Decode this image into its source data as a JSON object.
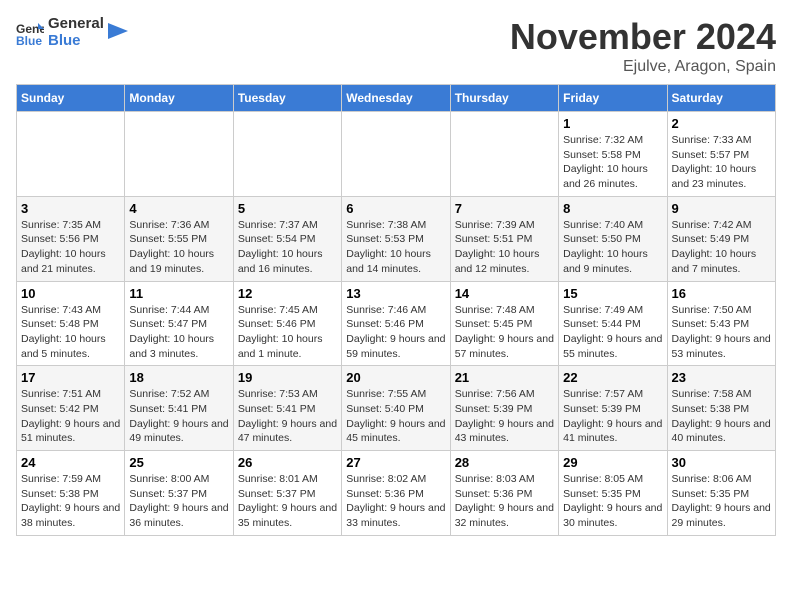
{
  "logo": {
    "line1": "General",
    "line2": "Blue"
  },
  "title": "November 2024",
  "location": "Ejulve, Aragon, Spain",
  "weekdays": [
    "Sunday",
    "Monday",
    "Tuesday",
    "Wednesday",
    "Thursday",
    "Friday",
    "Saturday"
  ],
  "weeks": [
    [
      {
        "day": "",
        "info": ""
      },
      {
        "day": "",
        "info": ""
      },
      {
        "day": "",
        "info": ""
      },
      {
        "day": "",
        "info": ""
      },
      {
        "day": "",
        "info": ""
      },
      {
        "day": "1",
        "info": "Sunrise: 7:32 AM\nSunset: 5:58 PM\nDaylight: 10 hours and 26 minutes."
      },
      {
        "day": "2",
        "info": "Sunrise: 7:33 AM\nSunset: 5:57 PM\nDaylight: 10 hours and 23 minutes."
      }
    ],
    [
      {
        "day": "3",
        "info": "Sunrise: 7:35 AM\nSunset: 5:56 PM\nDaylight: 10 hours and 21 minutes."
      },
      {
        "day": "4",
        "info": "Sunrise: 7:36 AM\nSunset: 5:55 PM\nDaylight: 10 hours and 19 minutes."
      },
      {
        "day": "5",
        "info": "Sunrise: 7:37 AM\nSunset: 5:54 PM\nDaylight: 10 hours and 16 minutes."
      },
      {
        "day": "6",
        "info": "Sunrise: 7:38 AM\nSunset: 5:53 PM\nDaylight: 10 hours and 14 minutes."
      },
      {
        "day": "7",
        "info": "Sunrise: 7:39 AM\nSunset: 5:51 PM\nDaylight: 10 hours and 12 minutes."
      },
      {
        "day": "8",
        "info": "Sunrise: 7:40 AM\nSunset: 5:50 PM\nDaylight: 10 hours and 9 minutes."
      },
      {
        "day": "9",
        "info": "Sunrise: 7:42 AM\nSunset: 5:49 PM\nDaylight: 10 hours and 7 minutes."
      }
    ],
    [
      {
        "day": "10",
        "info": "Sunrise: 7:43 AM\nSunset: 5:48 PM\nDaylight: 10 hours and 5 minutes."
      },
      {
        "day": "11",
        "info": "Sunrise: 7:44 AM\nSunset: 5:47 PM\nDaylight: 10 hours and 3 minutes."
      },
      {
        "day": "12",
        "info": "Sunrise: 7:45 AM\nSunset: 5:46 PM\nDaylight: 10 hours and 1 minute."
      },
      {
        "day": "13",
        "info": "Sunrise: 7:46 AM\nSunset: 5:46 PM\nDaylight: 9 hours and 59 minutes."
      },
      {
        "day": "14",
        "info": "Sunrise: 7:48 AM\nSunset: 5:45 PM\nDaylight: 9 hours and 57 minutes."
      },
      {
        "day": "15",
        "info": "Sunrise: 7:49 AM\nSunset: 5:44 PM\nDaylight: 9 hours and 55 minutes."
      },
      {
        "day": "16",
        "info": "Sunrise: 7:50 AM\nSunset: 5:43 PM\nDaylight: 9 hours and 53 minutes."
      }
    ],
    [
      {
        "day": "17",
        "info": "Sunrise: 7:51 AM\nSunset: 5:42 PM\nDaylight: 9 hours and 51 minutes."
      },
      {
        "day": "18",
        "info": "Sunrise: 7:52 AM\nSunset: 5:41 PM\nDaylight: 9 hours and 49 minutes."
      },
      {
        "day": "19",
        "info": "Sunrise: 7:53 AM\nSunset: 5:41 PM\nDaylight: 9 hours and 47 minutes."
      },
      {
        "day": "20",
        "info": "Sunrise: 7:55 AM\nSunset: 5:40 PM\nDaylight: 9 hours and 45 minutes."
      },
      {
        "day": "21",
        "info": "Sunrise: 7:56 AM\nSunset: 5:39 PM\nDaylight: 9 hours and 43 minutes."
      },
      {
        "day": "22",
        "info": "Sunrise: 7:57 AM\nSunset: 5:39 PM\nDaylight: 9 hours and 41 minutes."
      },
      {
        "day": "23",
        "info": "Sunrise: 7:58 AM\nSunset: 5:38 PM\nDaylight: 9 hours and 40 minutes."
      }
    ],
    [
      {
        "day": "24",
        "info": "Sunrise: 7:59 AM\nSunset: 5:38 PM\nDaylight: 9 hours and 38 minutes."
      },
      {
        "day": "25",
        "info": "Sunrise: 8:00 AM\nSunset: 5:37 PM\nDaylight: 9 hours and 36 minutes."
      },
      {
        "day": "26",
        "info": "Sunrise: 8:01 AM\nSunset: 5:37 PM\nDaylight: 9 hours and 35 minutes."
      },
      {
        "day": "27",
        "info": "Sunrise: 8:02 AM\nSunset: 5:36 PM\nDaylight: 9 hours and 33 minutes."
      },
      {
        "day": "28",
        "info": "Sunrise: 8:03 AM\nSunset: 5:36 PM\nDaylight: 9 hours and 32 minutes."
      },
      {
        "day": "29",
        "info": "Sunrise: 8:05 AM\nSunset: 5:35 PM\nDaylight: 9 hours and 30 minutes."
      },
      {
        "day": "30",
        "info": "Sunrise: 8:06 AM\nSunset: 5:35 PM\nDaylight: 9 hours and 29 minutes."
      }
    ]
  ]
}
